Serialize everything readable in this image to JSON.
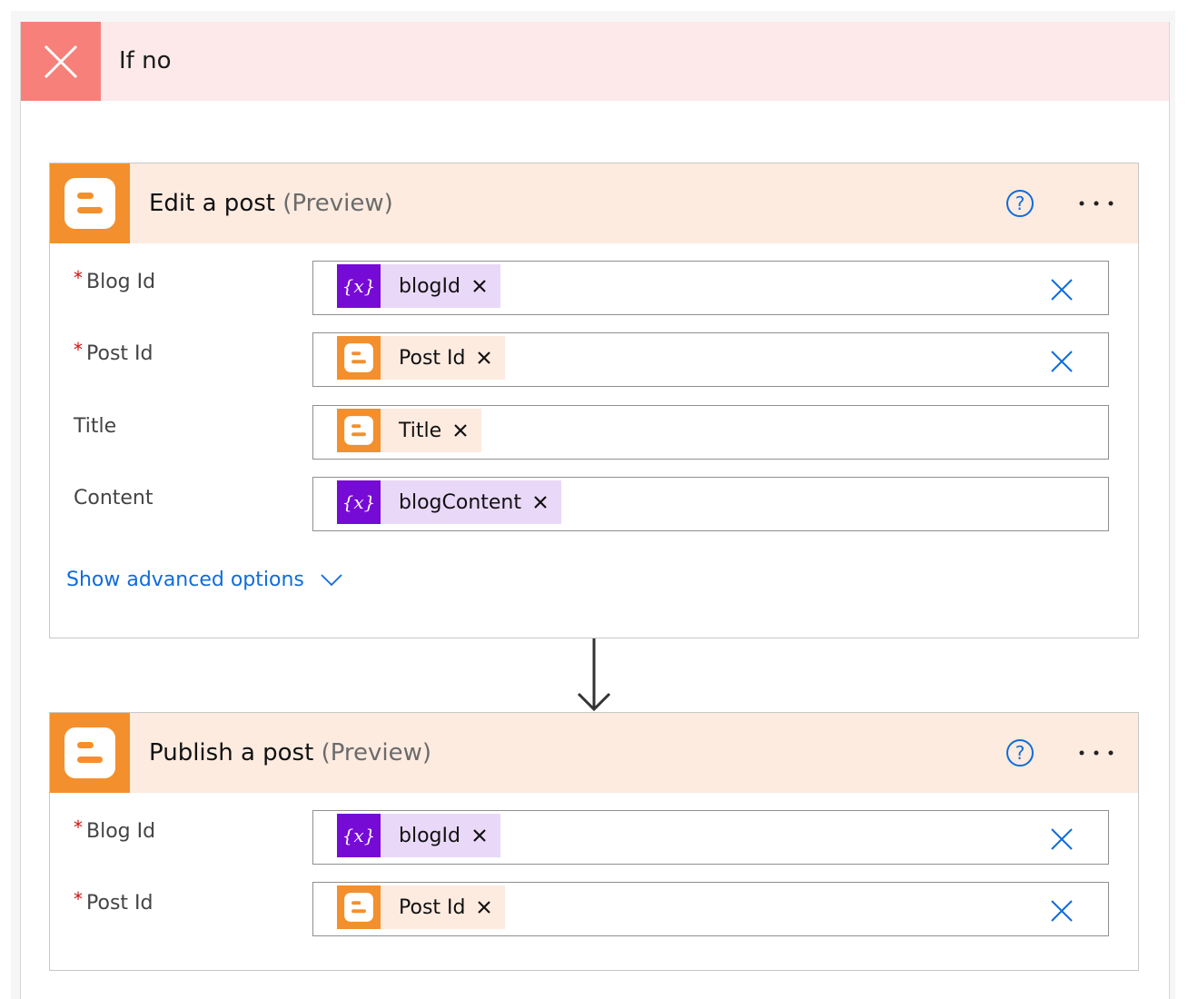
{
  "branch": {
    "title": "If no"
  },
  "cards": [
    {
      "title": "Edit a post",
      "subtitle": "(Preview)",
      "help_icon": "help-circle-icon",
      "more_icon": "more-ellipsis-icon",
      "fields": [
        {
          "label": "Blog Id",
          "required": "*",
          "token": "blogId",
          "token_type": "variable"
        },
        {
          "label": "Post Id",
          "required": "*",
          "token": "Post Id",
          "token_type": "blogger"
        },
        {
          "label": "Title",
          "required": "",
          "token": "Title",
          "token_type": "blogger"
        },
        {
          "label": "Content",
          "required": "",
          "token": "blogContent",
          "token_type": "variable"
        }
      ],
      "advanced_label": "Show advanced options"
    },
    {
      "title": "Publish a post",
      "subtitle": "(Preview)",
      "help_icon": "help-circle-icon",
      "more_icon": "more-ellipsis-icon",
      "fields": [
        {
          "label": "Blog Id",
          "required": "*",
          "token": "blogId",
          "token_type": "variable"
        },
        {
          "label": "Post Id",
          "required": "*",
          "token": "Post Id",
          "token_type": "blogger"
        }
      ]
    }
  ],
  "colors": {
    "if_no_header": "#fde9e9",
    "if_no_icon": "#f7817a",
    "blogger_orange": "#f3902d",
    "variable_purple": "#770bd6",
    "link_blue": "#0f6cdb",
    "required_red": "#d01010"
  }
}
